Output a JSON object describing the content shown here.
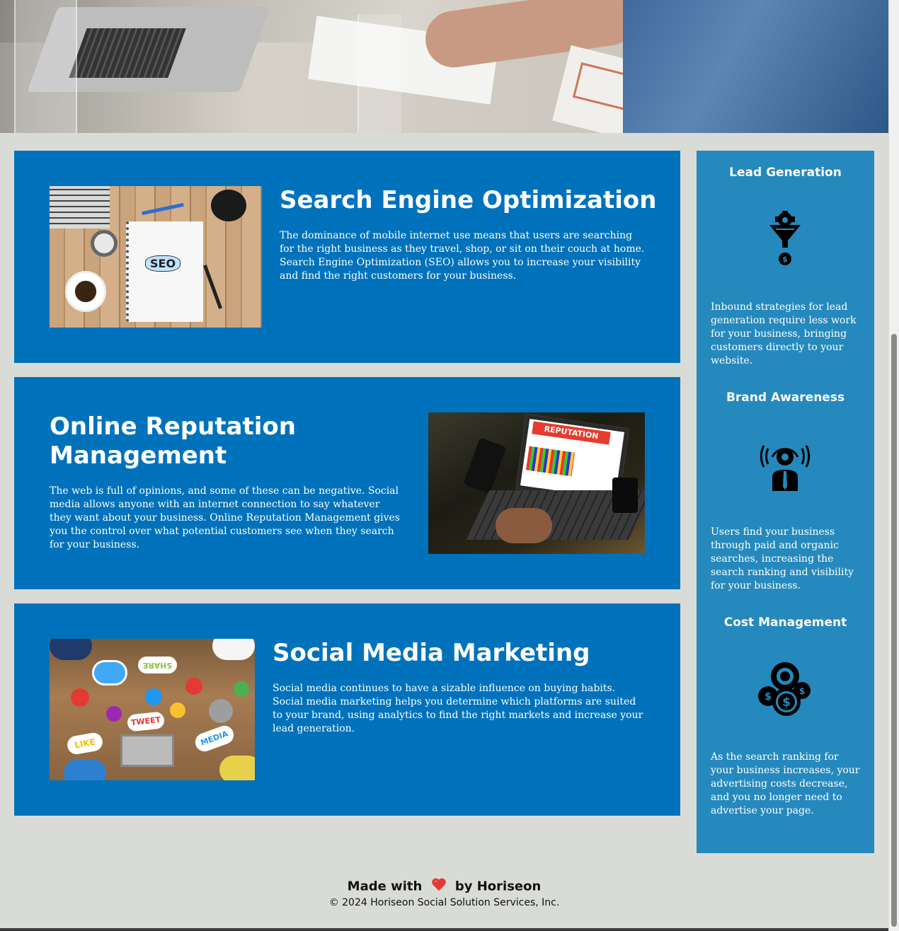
{
  "sections": [
    {
      "title": "Search Engine Optimization",
      "text": "The dominance of mobile internet use means that users are searching for the right business as they travel, shop, or sit on their couch at home. Search Engine Optimization (SEO) allows you to increase your visibility and find the right customers for your business.",
      "image_alt": "seo-image",
      "image_text": "SEO"
    },
    {
      "title": "Online Reputation Management",
      "text": "The web is full of opinions, and some of these can be negative. Social media allows anyone with an internet connection to say whatever they want about your business. Online Reputation Management gives you the control over what potential customers see when they search for your business.",
      "image_alt": "reputation-image",
      "image_text": "REPUTATION"
    },
    {
      "title": "Social Media Marketing",
      "text": "Social media continues to have a sizable influence on buying habits. Social media marketing helps you determine which platforms are suited to your brand, using analytics to find the right markets and increase your lead generation.",
      "image_alt": "social-media-image",
      "image_words": [
        "SHARE",
        "TWEET",
        "LIKE",
        "MEDIA"
      ]
    }
  ],
  "sidebar": [
    {
      "title": "Lead Generation",
      "icon": "lead-generation-icon",
      "text": "Inbound strategies for lead generation require less work for your business, bringing customers directly to your website."
    },
    {
      "title": "Brand Awareness",
      "icon": "brand-awareness-icon",
      "text": "Users find your business through paid and organic searches, increasing the search ranking and visibility for your business."
    },
    {
      "title": "Cost Management",
      "icon": "cost-management-icon",
      "text": "As the search ranking for your business increases, your advertising costs decrease, and you no longer need to advertise your page."
    }
  ],
  "footer": {
    "made_with": "Made with",
    "by": "by Horiseon",
    "heart_icon": "heart-icon",
    "copyright": "© 2024 Horiseon Social Solution Services, Inc."
  },
  "colors": {
    "page_bg": "#d9dcd6",
    "card_bg": "#0072bb",
    "sidebar_bg": "#2589bd",
    "heart": "#e53935"
  }
}
